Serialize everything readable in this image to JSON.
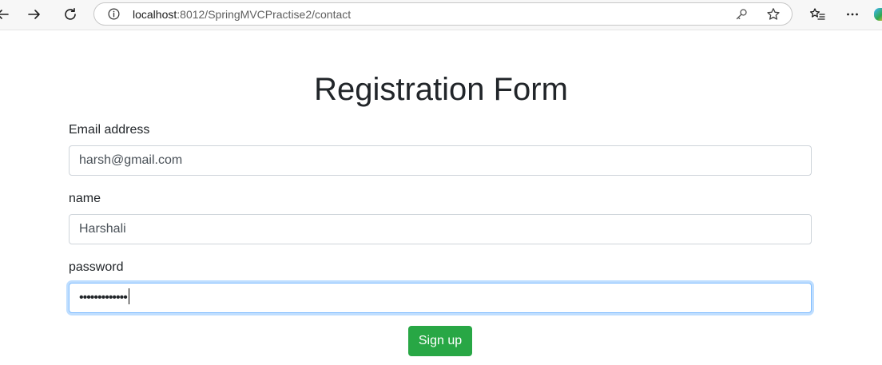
{
  "browser": {
    "url_host": "localhost",
    "url_path": ":8012/SpringMVCPractise2/contact"
  },
  "form": {
    "title": "Registration Form",
    "email": {
      "label": "Email address",
      "value": "harsh@gmail.com"
    },
    "name": {
      "label": "name",
      "value": "Harshali"
    },
    "password": {
      "label": "password",
      "masked_value": "•••••••••••••"
    },
    "submit_label": "Sign up"
  },
  "colors": {
    "primary_button": "#28a745",
    "focus_ring": "#80bdff"
  }
}
